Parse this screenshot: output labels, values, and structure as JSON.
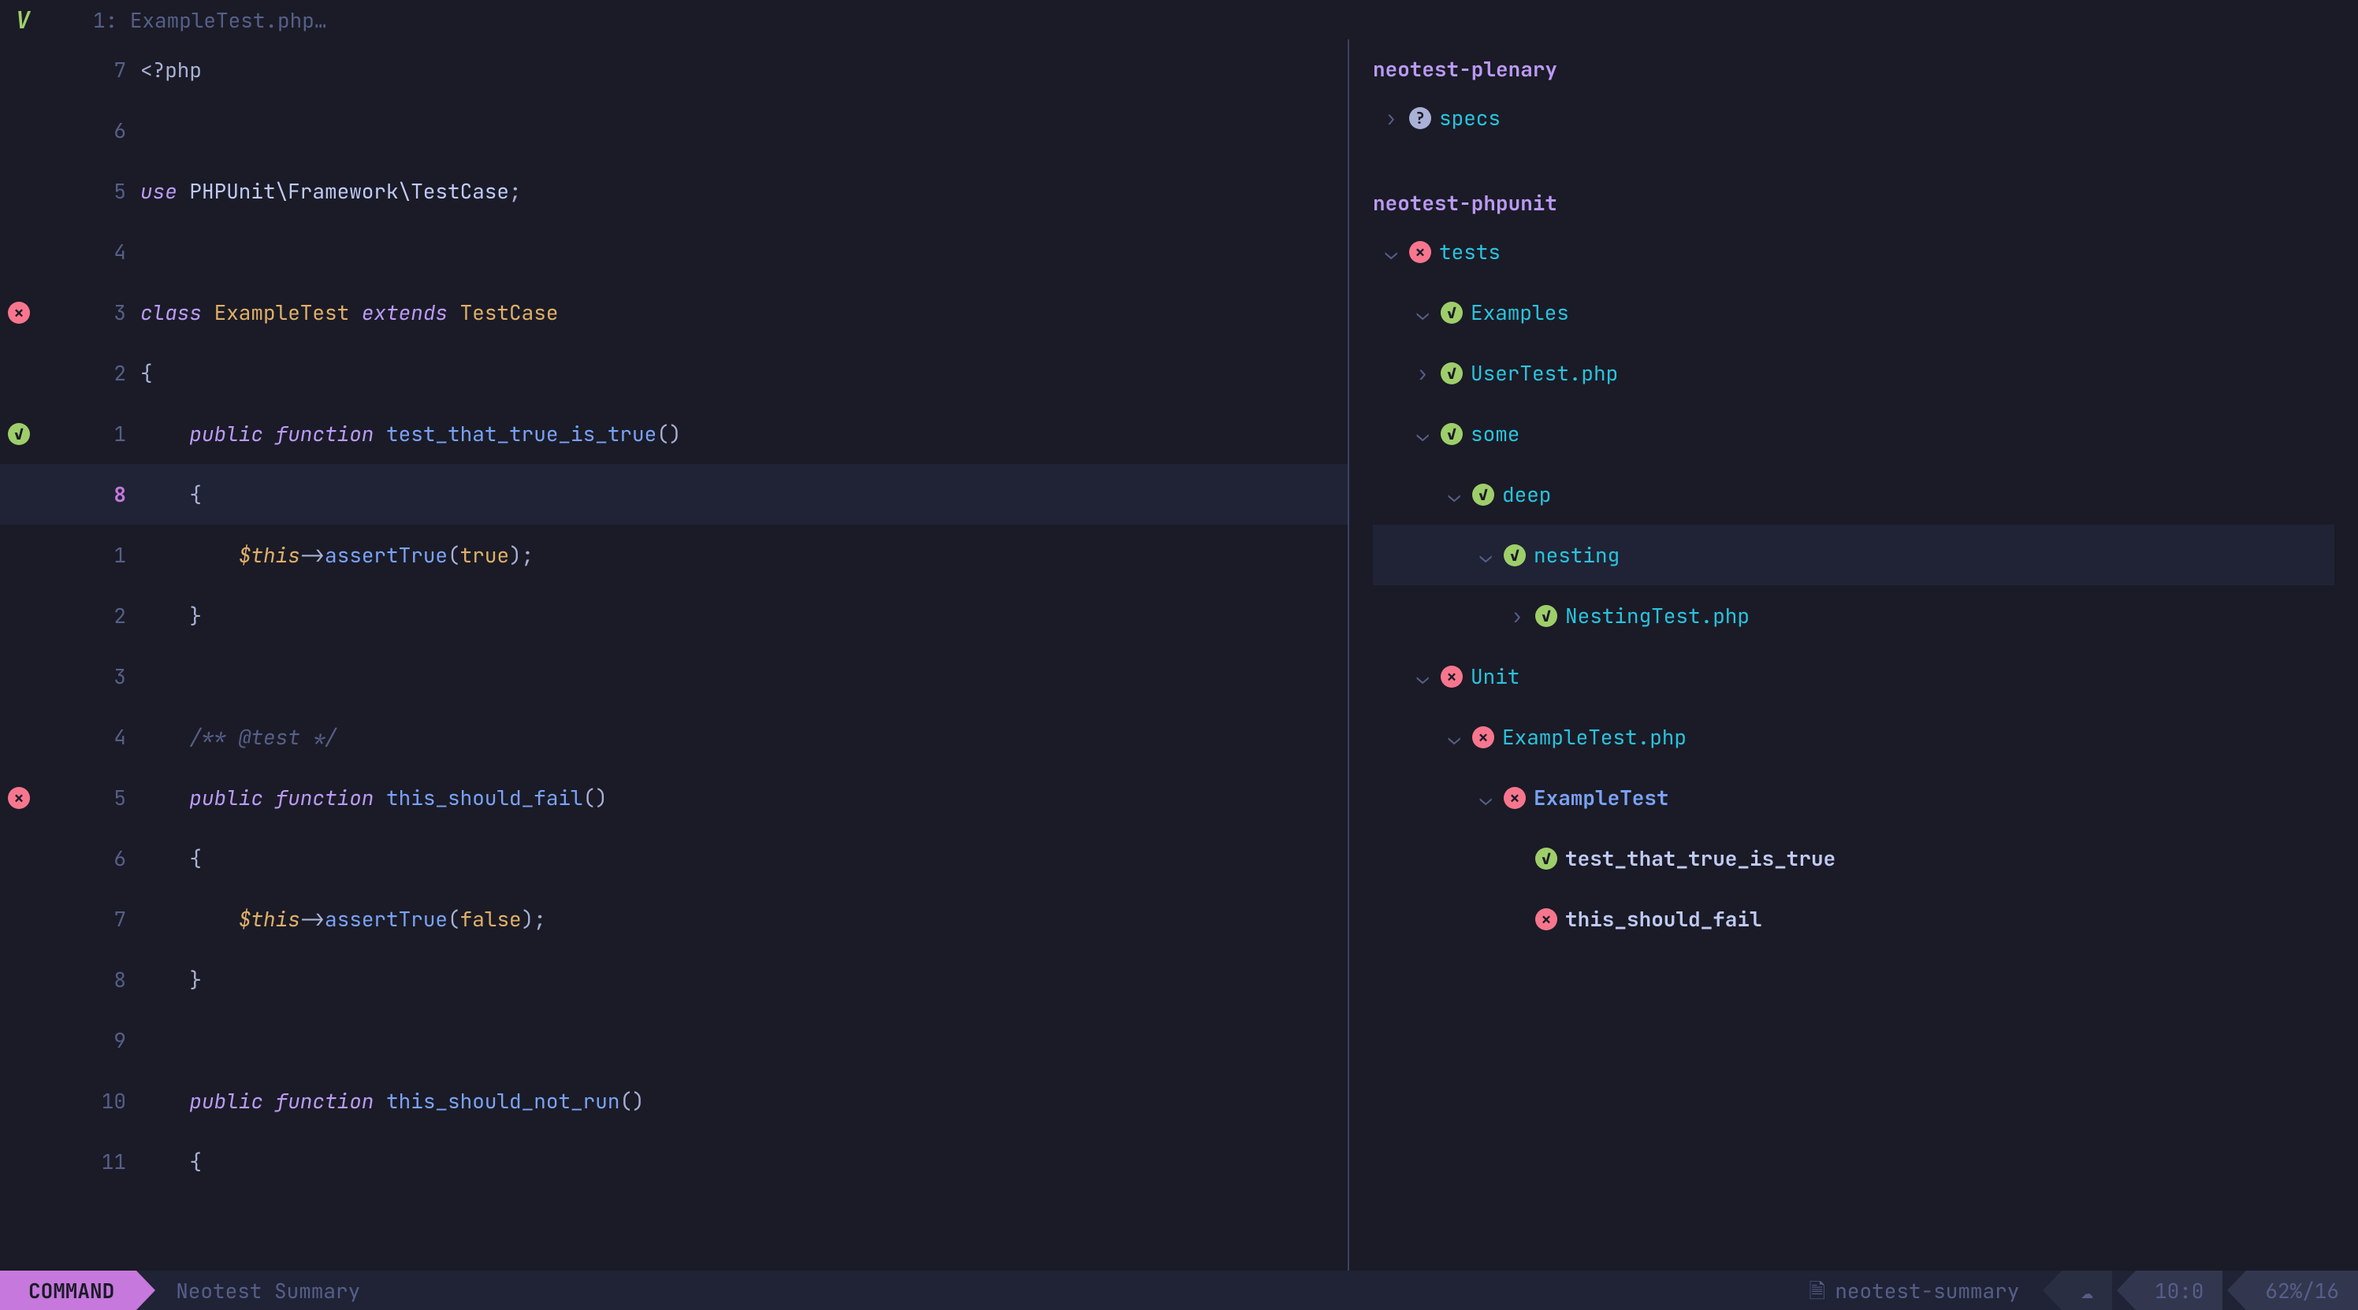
{
  "tabbar": {
    "index": "1:",
    "filename": "ExampleTest.php…"
  },
  "editor": {
    "lines": [
      {
        "rel": "7",
        "sign": null,
        "tokens": [
          [
            "<?php",
            "punct"
          ]
        ]
      },
      {
        "rel": "6",
        "sign": null,
        "tokens": []
      },
      {
        "rel": "5",
        "sign": null,
        "tokens": [
          [
            "use ",
            "kw"
          ],
          [
            "PHPUnit\\Framework\\TestCase",
            "ns"
          ],
          [
            ";",
            "punct"
          ]
        ]
      },
      {
        "rel": "4",
        "sign": null,
        "tokens": []
      },
      {
        "rel": "3",
        "sign": "fail",
        "tokens": [
          [
            "class ",
            "kw"
          ],
          [
            "ExampleTest",
            "cls"
          ],
          [
            " extends ",
            "kw"
          ],
          [
            "TestCase",
            "cls"
          ]
        ]
      },
      {
        "rel": "2",
        "sign": null,
        "tokens": [
          [
            "{",
            "punct"
          ]
        ]
      },
      {
        "rel": "1",
        "sign": "pass",
        "tokens": [
          [
            "    ",
            ""
          ],
          [
            "public ",
            "kw"
          ],
          [
            "function ",
            "kw"
          ],
          [
            "test_that_true_is_true",
            "fn"
          ],
          [
            "()",
            "punct"
          ]
        ]
      },
      {
        "rel": "8",
        "sign": null,
        "cursor": true,
        "tokens": [
          [
            "    {",
            "punct"
          ]
        ]
      },
      {
        "rel": "1",
        "sign": null,
        "tokens": [
          [
            "        ",
            ""
          ],
          [
            "$this",
            "var"
          ],
          [
            "->",
            "punct"
          ],
          [
            "assertTrue",
            "fn"
          ],
          [
            "(",
            "punct"
          ],
          [
            "true",
            "const"
          ],
          [
            ");",
            "punct"
          ]
        ]
      },
      {
        "rel": "2",
        "sign": null,
        "tokens": [
          [
            "    }",
            "punct"
          ]
        ]
      },
      {
        "rel": "3",
        "sign": null,
        "tokens": []
      },
      {
        "rel": "4",
        "sign": null,
        "tokens": [
          [
            "    ",
            ""
          ],
          [
            "/** @test */",
            "comment"
          ]
        ]
      },
      {
        "rel": "5",
        "sign": "fail",
        "tokens": [
          [
            "    ",
            ""
          ],
          [
            "public ",
            "kw"
          ],
          [
            "function ",
            "kw"
          ],
          [
            "this_should_fail",
            "fn"
          ],
          [
            "()",
            "punct"
          ]
        ]
      },
      {
        "rel": "6",
        "sign": null,
        "tokens": [
          [
            "    {",
            "punct"
          ]
        ]
      },
      {
        "rel": "7",
        "sign": null,
        "tokens": [
          [
            "        ",
            ""
          ],
          [
            "$this",
            "var"
          ],
          [
            "->",
            "punct"
          ],
          [
            "assertTrue",
            "fn"
          ],
          [
            "(",
            "punct"
          ],
          [
            "false",
            "const"
          ],
          [
            ");",
            "punct"
          ]
        ]
      },
      {
        "rel": "8",
        "sign": null,
        "tokens": [
          [
            "    }",
            "punct"
          ]
        ]
      },
      {
        "rel": "9",
        "sign": null,
        "tokens": []
      },
      {
        "rel": "10",
        "sign": null,
        "tokens": [
          [
            "    ",
            ""
          ],
          [
            "public ",
            "kw"
          ],
          [
            "function ",
            "kw"
          ],
          [
            "this_should_not_run",
            "fn"
          ],
          [
            "()",
            "punct"
          ]
        ]
      },
      {
        "rel": "11",
        "sign": null,
        "tokens": [
          [
            "    {",
            "punct"
          ]
        ]
      }
    ]
  },
  "summary": {
    "adapters": [
      {
        "name": "neotest-plenary",
        "rows": [
          {
            "indent": 0,
            "chev": "right",
            "icon": "unknown",
            "label": "specs",
            "style": ""
          }
        ]
      },
      {
        "name": "neotest-phpunit",
        "rows": [
          {
            "indent": 0,
            "chev": "down",
            "icon": "fail",
            "label": "tests",
            "style": ""
          },
          {
            "indent": 1,
            "chev": "down",
            "icon": "pass",
            "label": "Examples",
            "style": ""
          },
          {
            "indent": 1,
            "chev": "right",
            "icon": "pass",
            "label": "UserTest.php",
            "style": ""
          },
          {
            "indent": 1,
            "chev": "down",
            "icon": "pass",
            "label": "some",
            "style": ""
          },
          {
            "indent": 2,
            "chev": "down",
            "icon": "pass",
            "label": "deep",
            "style": ""
          },
          {
            "indent": 3,
            "chev": "down",
            "icon": "pass",
            "label": "nesting",
            "style": "",
            "hl": true
          },
          {
            "indent": 4,
            "chev": "right",
            "icon": "pass",
            "label": "NestingTest.php",
            "style": ""
          },
          {
            "indent": 1,
            "chev": "down",
            "icon": "fail",
            "label": "Unit",
            "style": ""
          },
          {
            "indent": 2,
            "chev": "down",
            "icon": "fail",
            "label": "ExampleTest.php",
            "style": ""
          },
          {
            "indent": 3,
            "chev": "down",
            "icon": "fail",
            "label": "ExampleTest",
            "style": "bold"
          },
          {
            "indent": 4,
            "chev": "",
            "icon": "pass",
            "label": "test_that_true_is_true",
            "style": "white"
          },
          {
            "indent": 4,
            "chev": "",
            "icon": "fail",
            "label": "this_should_fail",
            "style": "white"
          }
        ]
      }
    ]
  },
  "statusline": {
    "mode": "COMMAND",
    "title": "Neotest Summary",
    "file": "neotest-summary",
    "pos": "10:0",
    "percent": "62%/16"
  }
}
